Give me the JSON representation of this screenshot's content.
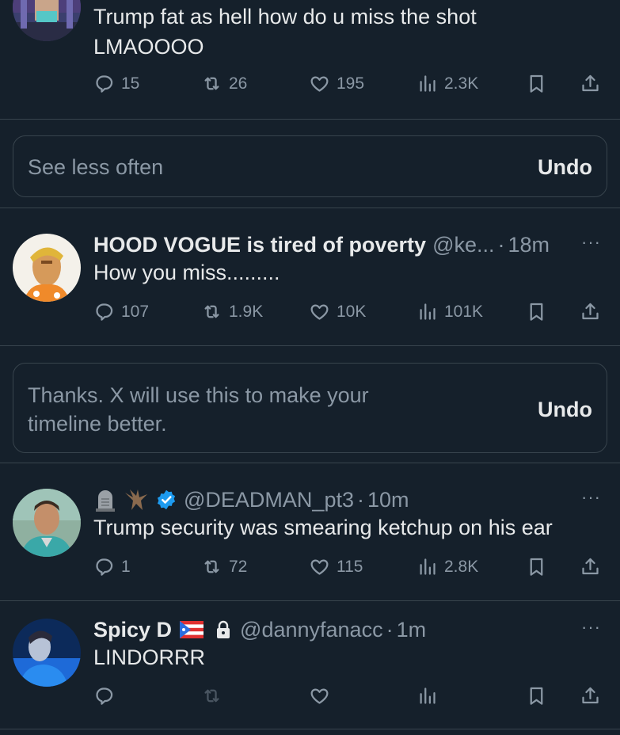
{
  "tweets": [
    {
      "text": "Trump fat as hell how do u miss the shot LMAOOOO",
      "replies": "15",
      "retweets": "26",
      "likes": "195",
      "views": "2.3K"
    },
    {
      "name": "HOOD VOGUE is tired of poverty",
      "handle": "@ke...",
      "sep": "·",
      "time": "18m",
      "text": "How you miss.........",
      "replies": "107",
      "retweets": "1.9K",
      "likes": "10K",
      "views": "101K",
      "more": "···"
    },
    {
      "handle": "@DEADMAN_pt3",
      "sep": "·",
      "time": "10m",
      "text": "Trump security was smearing ketchup on his ear",
      "replies": "1",
      "retweets": "72",
      "likes": "115",
      "views": "2.8K",
      "more": "···"
    },
    {
      "name": "Spicy D",
      "handle": "@dannyfanacc",
      "sep": "·",
      "time": "1m",
      "text": "LINDORRR",
      "more": "···"
    }
  ],
  "notices": [
    {
      "text": "See less often",
      "undo": "Undo"
    },
    {
      "text": "Thanks. X will use this to make your timeline better.",
      "undo": "Undo"
    }
  ],
  "colors": {
    "background": "#15202b",
    "text": "#e7e9ea",
    "secondary": "#8b98a5",
    "border": "#38444d",
    "verified": "#1d9bf0"
  },
  "icons": [
    "reply-icon",
    "retweet-icon",
    "like-icon",
    "views-icon",
    "bookmark-icon",
    "share-icon",
    "verified-icon",
    "lock-icon",
    "flag-icon",
    "tombstone-icon",
    "dragon-icon"
  ]
}
